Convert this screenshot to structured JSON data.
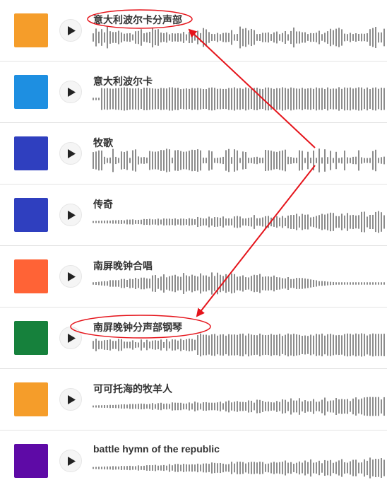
{
  "tracks": [
    {
      "title": "意大利波尔卡分声部",
      "cover_color": "#f59d2a",
      "wave_profile": "burst"
    },
    {
      "title": "意大利波尔卡",
      "cover_color": "#1e8fe1",
      "wave_profile": "dense"
    },
    {
      "title": "牧歌",
      "cover_color": "#2f3fbf",
      "wave_profile": "sparse"
    },
    {
      "title": "传奇",
      "cover_color": "#2f3fbf",
      "wave_profile": "ramp"
    },
    {
      "title": "南屏晚钟合唱",
      "cover_color": "#ff6336",
      "wave_profile": "swell"
    },
    {
      "title": "南屏晚钟分声部钢琴",
      "cover_color": "#16813c",
      "wave_profile": "late-dense"
    },
    {
      "title": "可可托海的牧羊人",
      "cover_color": "#f59d2a",
      "wave_profile": "ramp"
    },
    {
      "title": "battle hymn of the republic",
      "cover_color": "#5e0aa6",
      "wave_profile": "ramp"
    }
  ],
  "icons": {
    "play": "play-triangle"
  },
  "colors": {
    "annotation": "#e5141b",
    "waveform": "#8c8c8c"
  }
}
